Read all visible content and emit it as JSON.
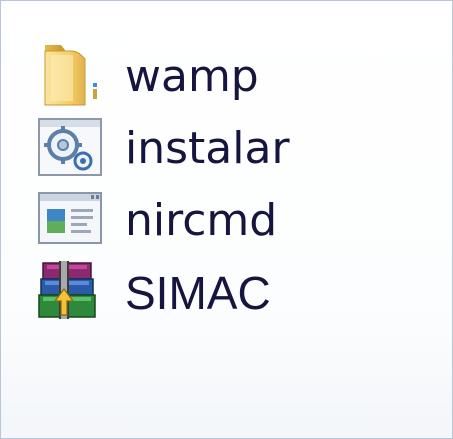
{
  "files": [
    {
      "name": "wamp",
      "icon": "folder-icon"
    },
    {
      "name": "instalar",
      "icon": "config-file-icon"
    },
    {
      "name": "nircmd",
      "icon": "application-icon"
    },
    {
      "name": "SIMAC",
      "icon": "winrar-archive-icon"
    }
  ]
}
